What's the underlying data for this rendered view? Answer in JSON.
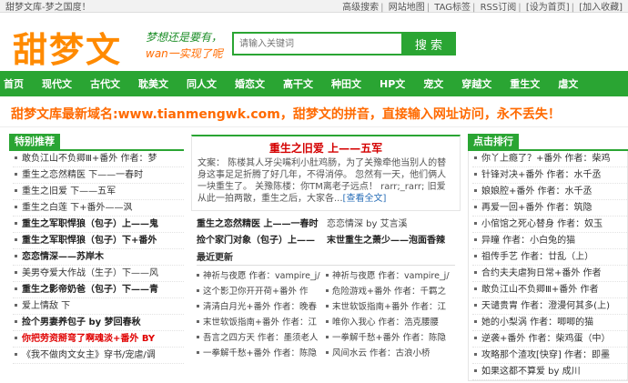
{
  "topbar": {
    "site_name": "甜梦文库-梦之国度！",
    "links": [
      "高级搜索",
      "网站地图",
      "TAG标签",
      "RSS订阅",
      "[设为首页]",
      "[加入收藏]"
    ]
  },
  "header": {
    "logo": "甜梦文",
    "slogan_line1": "梦想还是要有，",
    "slogan_line2": "wan一实现了呢",
    "search_placeholder": "请输入关键词",
    "search_button": "搜 索"
  },
  "nav": [
    "首页",
    "现代文",
    "古代文",
    "耽美文",
    "同人文",
    "婚恋文",
    "高干文",
    "种田文",
    "HP文",
    "宠文",
    "穿越文",
    "重生文",
    "虐文"
  ],
  "banner": "甜梦文库最新域名:www.tianmengwk.com，甜梦文的拼音，直接输入网址访问，永不丢失！",
  "left": {
    "title": "特别推荐",
    "items": [
      {
        "text": "敢负江山不负卿Ⅲ+番外 作者：梦",
        "style": "normal"
      },
      {
        "text": "重生之恋然精医 下——一春时",
        "style": "normal"
      },
      {
        "text": "重生之旧爱 下——五军",
        "style": "normal"
      },
      {
        "text": "重生之白莲 下+番外——沨",
        "style": "normal"
      },
      {
        "text": "重生之军职悍狼（包子）上——鬼",
        "style": "bold"
      },
      {
        "text": "重生之军职悍狼（包子）下+番外",
        "style": "bold"
      },
      {
        "text": "恋恋情深——苏岸木",
        "style": "bold"
      },
      {
        "text": "美男夺爱大作战（生子）下——风",
        "style": "normal"
      },
      {
        "text": "重生之影帝奶爸（包子）下——青",
        "style": "bold"
      },
      {
        "text": "爱上情敌 下",
        "style": "normal"
      },
      {
        "text": "捡个男妻养包子 by 梦回春秋",
        "style": "bold"
      },
      {
        "text": "你把劳资掰弯了啊魂淡+番外 BY",
        "style": "red"
      },
      {
        "text": "《我不做肉文女主》穿书/宠虐/调",
        "style": "normal"
      }
    ]
  },
  "feature": {
    "title": "重生之旧爱 上——五军",
    "text": "文案： 陈楼其人牙尖嘴利小肚鸡肠，为了关豫牵他当别人的替身这事足足折腾了好几年，不得消停。 忽然有一天，他们俩人一块重生了。 关豫陈楼：你TM离老子远点！ rarr;_rarr; 旧爱从此一拍两散，重生之后，大家各...",
    "more": "[查看全文]"
  },
  "mid_links": [
    {
      "text": "重生之恋然精医 上——一春时",
      "bold": true
    },
    {
      "text": "恋恋情深 by 艾言溪",
      "bold": false
    },
    {
      "text": "捡个家门对象（包子）上——",
      "bold": true
    },
    {
      "text": "末世重生之萧少——泡面香辣",
      "bold": true
    }
  ],
  "latest": {
    "title": "最近更新",
    "items": [
      "神祈与夜愿 作者：vampire_j/",
      "神祈与夜愿 作者：vampire_j/",
      "这个影卫你开开荷+番外 作",
      "危险游戏+番外 作者：千羁之",
      "清清白月光+番外 作者：晚春",
      "末世软饭指南+番外 作者：江",
      "末世软饭指南+番外 作者：江",
      "唯你入我心 作者：浩克腰腰",
      "吾言之四方天 作者：墨须老人",
      "一拳解千愁+番外 作者：陈隐",
      "一拳解千愁+番外 作者：陈隐",
      "风间水云 作者：古浪小桥"
    ]
  },
  "right": {
    "title": "点击排行",
    "items": [
      "你丫上瘾了？+番外 作者：柴鸡",
      "针锋对决+番外 作者：水千丞",
      "娘娘腔+番外 作者：水千丞",
      "再爱一回+番外 作者：筑隐",
      "小倌馆之死心替身 作者：奴玉",
      "异瞳 作者：小白兔的猫",
      "祖传手艺 作者：廿乱（上）",
      "合约夫夫虐狗日常+番外 作者",
      "敢负江山不负卿Ⅲ+番外 作者",
      "天谴贵胄 作者：澄漫何其多(上)",
      "她的小梨涡 作者：唧唧的猫",
      "逆袭+番外 作者：柴鸡蛋（中）",
      "攻略那个渣攻[快穿] 作者：即墨",
      "如果这都不算爱 by 成川"
    ]
  }
}
